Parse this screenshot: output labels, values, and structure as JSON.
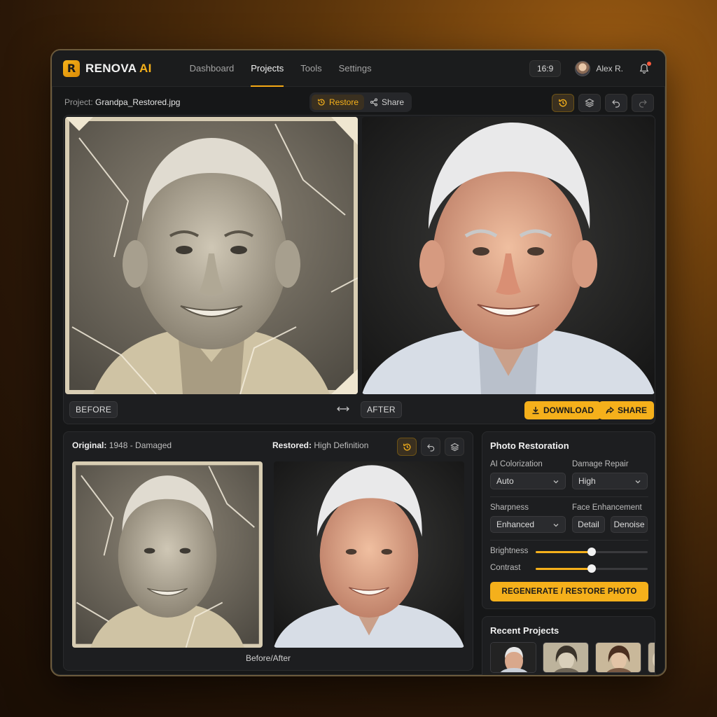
{
  "app": {
    "brand": "RENOVA",
    "brand_ai": "AI",
    "nav": [
      "Dashboard",
      "Projects",
      "Tools",
      "Settings"
    ],
    "active_nav": "Projects",
    "ratio": "16:9",
    "user": "Alex R."
  },
  "toolbar": {
    "project_prefix": "Project:",
    "project_name": "Grandpa_Restored.jpg",
    "restore_label": "Restore",
    "share_label": "Share"
  },
  "compare": {
    "before_label": "BEFORE",
    "after_label": "AFTER",
    "download_label": "DOWNLOAD",
    "share_label": "SHARE"
  },
  "detail": {
    "original_prefix": "Original:",
    "original_value": "1948 - Damaged",
    "restored_prefix": "Restored:",
    "restored_value": "High Definition",
    "caption": "Before/After"
  },
  "restoration": {
    "title": "Photo Restoration",
    "colorization_label": "AI Colorization",
    "colorization_value": "Auto",
    "damage_label": "Damage Repair",
    "damage_value": "High",
    "sharpness_label": "Sharpness",
    "sharpness_value": "Enhanced",
    "face_label": "Face Enhancement",
    "face_options": [
      "Detail",
      "Denoise"
    ],
    "brightness_label": "Brightness",
    "brightness_value": 0.5,
    "contrast_label": "Contrast",
    "contrast_value": 0.5,
    "regen_label": "REGENERATE / RESTORE PHOTO"
  },
  "recent": {
    "title": "Recent Projects"
  },
  "colors": {
    "accent": "#f5b01b",
    "panel": "#1d1e20",
    "app_bg": "#161718"
  }
}
